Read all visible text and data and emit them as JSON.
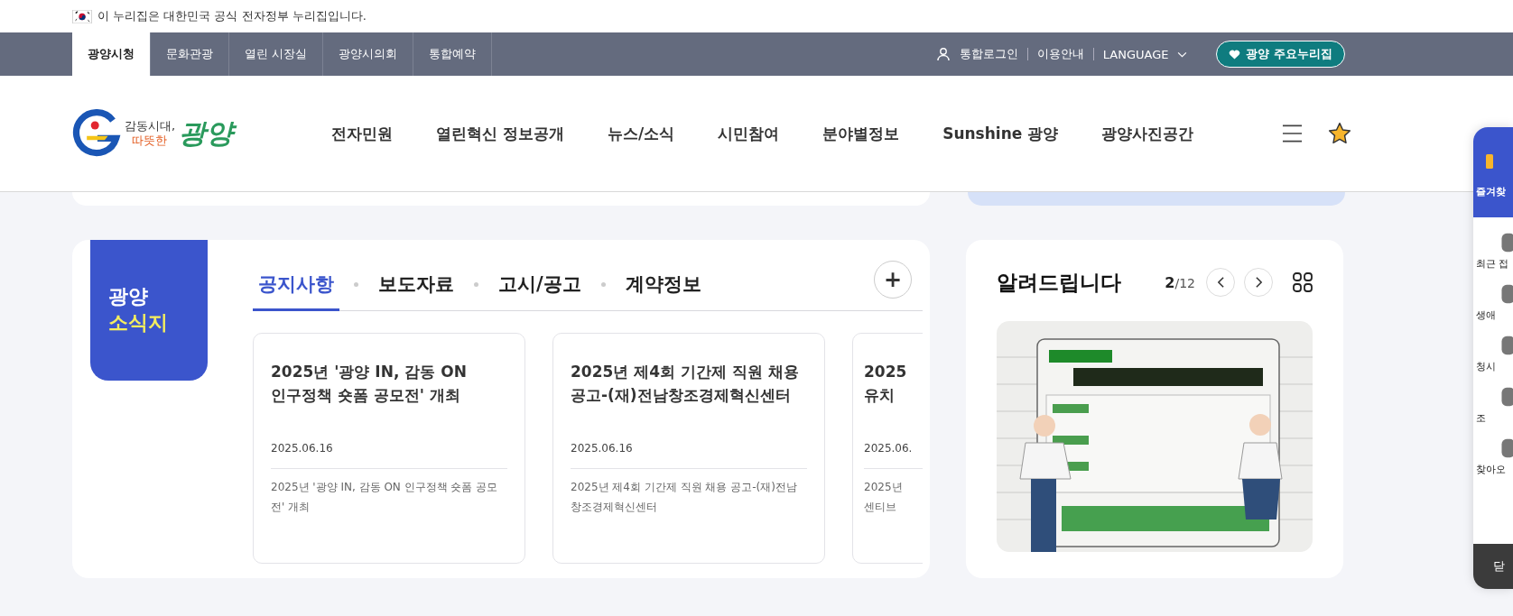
{
  "gov_notice": {
    "text": "이 누리집은 대한민국 공식 전자정부 누리집입니다."
  },
  "util_tabs": [
    {
      "label": "광양시청",
      "selected": true
    },
    {
      "label": "문화관광",
      "selected": false
    },
    {
      "label": "열린 시장실",
      "selected": false
    },
    {
      "label": "광양시의회",
      "selected": false
    },
    {
      "label": "통합예약",
      "selected": false
    }
  ],
  "util_links": {
    "login": "통합로그인",
    "guide": "이용안내",
    "language": "LANGUAGE",
    "main_sites": "광양 주요누리집"
  },
  "logo": {
    "line_1": "감동시대,",
    "line_2": "따뜻한",
    "name": "광양"
  },
  "main_menu": [
    "전자민원",
    "열린혁신 정보공개",
    "뉴스/소식",
    "시민참여",
    "분야별정보",
    "Sunshine 광양",
    "광양사진공간"
  ],
  "news": {
    "tag_line_1": "광양",
    "tag_line_2": "소식지",
    "tabs": [
      {
        "label": "공지사항",
        "selected": true
      },
      {
        "label": "보도자료",
        "selected": false
      },
      {
        "label": "고시/공고",
        "selected": false
      },
      {
        "label": "계약정보",
        "selected": false
      }
    ],
    "more": "+",
    "items": [
      {
        "title_lines": [
          "2025년 '광양 IN, 감동 ON",
          "인구정책 숏폼 공모전' 개최"
        ],
        "date": "2025.06.16",
        "summary_lines": [
          "2025년 '광양 IN, 감동 ON 인구정책 숏폼 공모",
          "전' 개최"
        ]
      },
      {
        "title_lines": [
          "2025년 제4회 기간제 직원 채용",
          "공고-(재)전남창조경제혁신센터"
        ],
        "date": "2025.06.16",
        "summary_lines": [
          "2025년 제4회 기간제 직원 채용 공고-(재)전남",
          "창조경제혁신센터"
        ]
      },
      {
        "title_lines": [
          "2025",
          "유치"
        ],
        "date": "2025.06.",
        "summary_lines": [
          "2025년",
          "센티브"
        ]
      }
    ]
  },
  "notice": {
    "title": "알려드립니다",
    "current": "2",
    "total": "/12"
  },
  "side_panel": {
    "header": "즐겨찾",
    "items": [
      "최근 접",
      "생애",
      "청시",
      "조",
      "찾아오"
    ],
    "close": "닫"
  }
}
